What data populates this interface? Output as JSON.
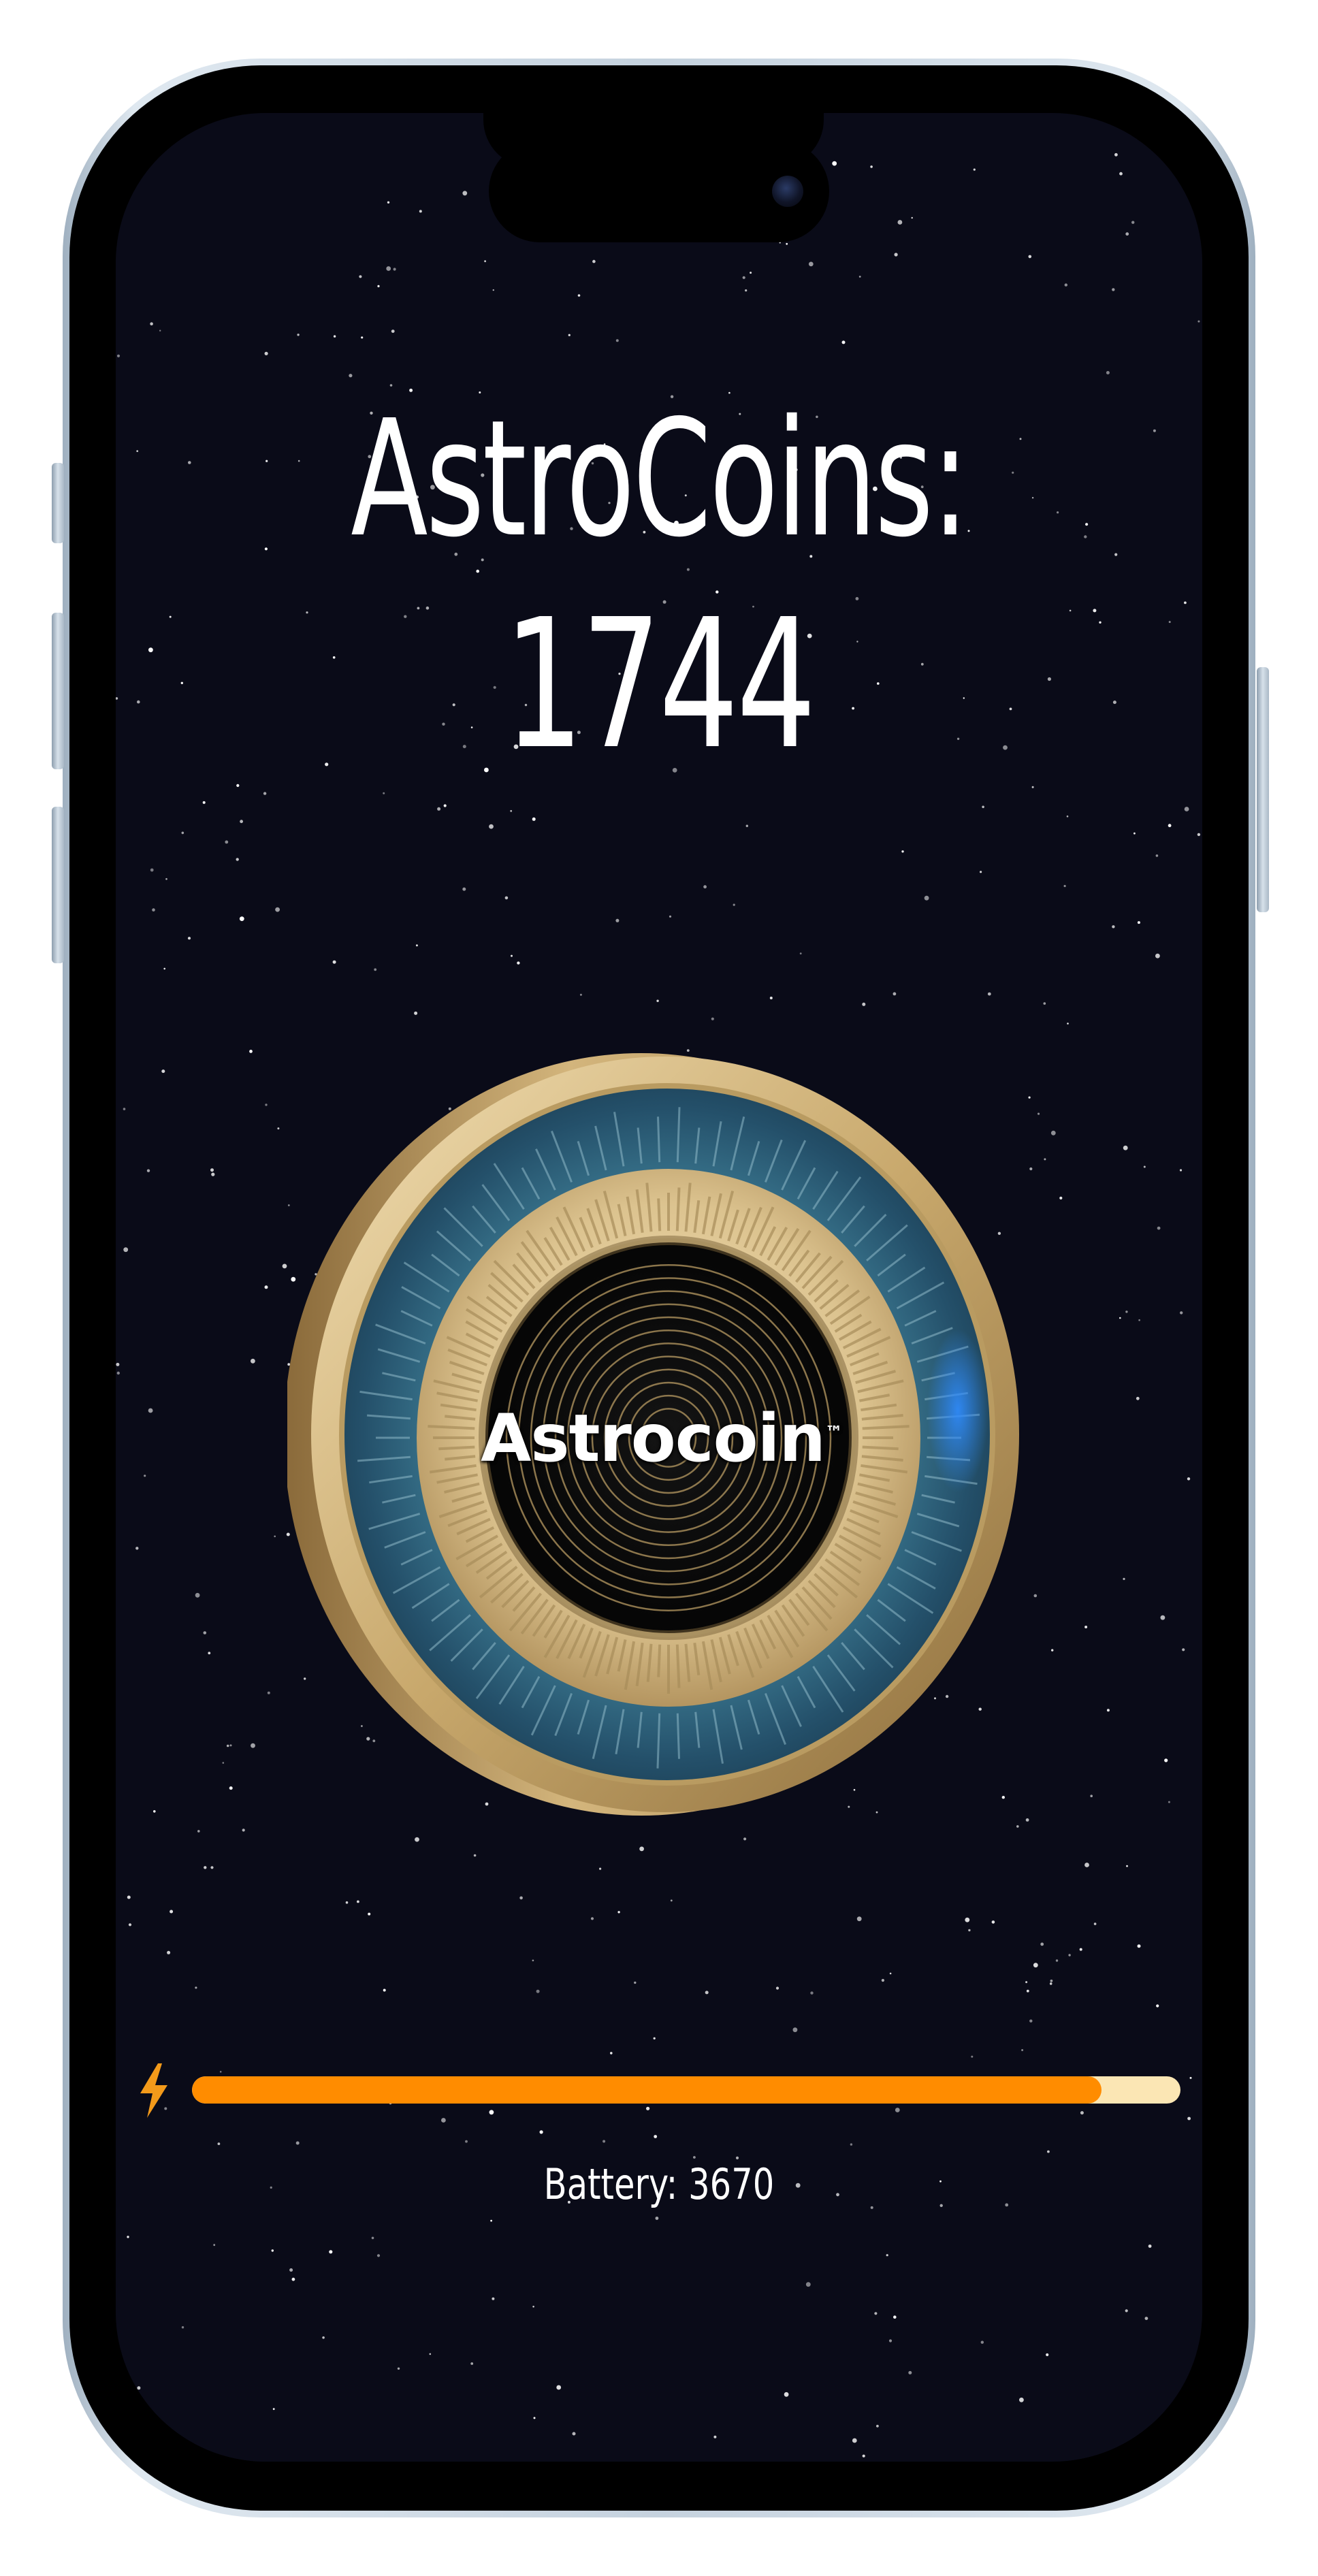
{
  "app": {
    "title_label": "AstroCoins:",
    "coin_count": "1744",
    "coin_logo_text": "Astrocoin",
    "coin_logo_mark": "™"
  },
  "energy": {
    "icon": "lightning-bolt-icon",
    "fill_fraction": 0.92,
    "battery_text": "Battery: 3670"
  },
  "colors": {
    "background": "#0a0b18",
    "text": "#ffffff",
    "bar_fill": "#ff8c00",
    "bar_track": "#fbe6b4",
    "bolt": "#f39a1a",
    "coin_gold": "#d9c08a",
    "coin_teal": "#2d5f77"
  }
}
